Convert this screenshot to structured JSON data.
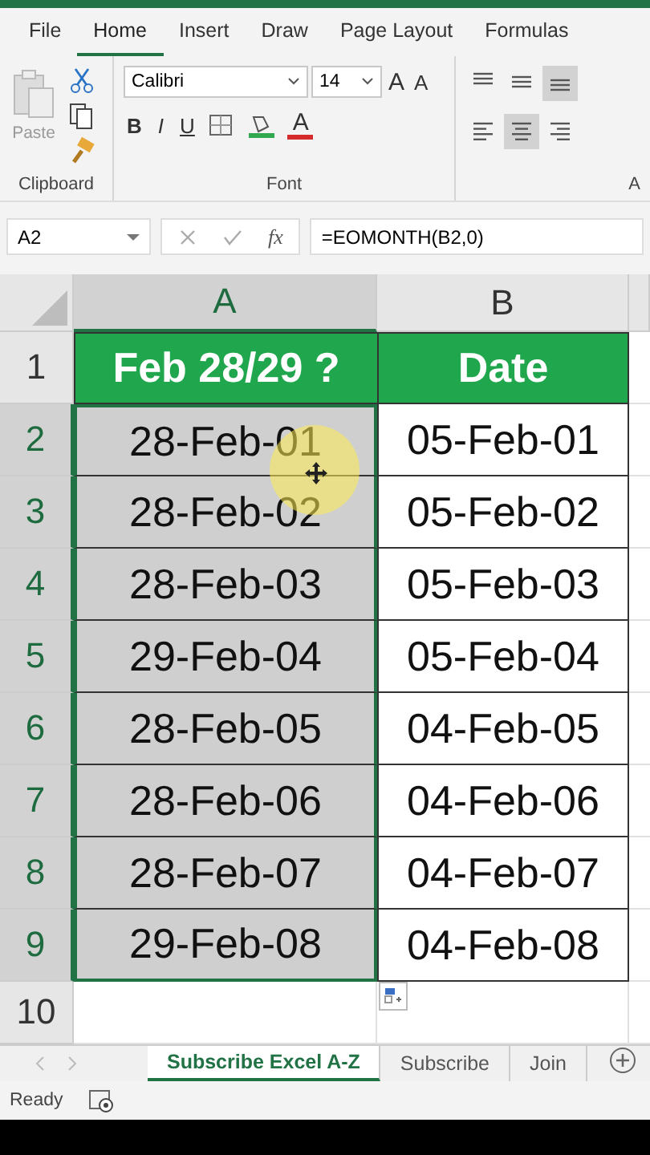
{
  "ribbon_tabs": [
    {
      "label": "File",
      "selected": false
    },
    {
      "label": "Home",
      "selected": true
    },
    {
      "label": "Insert",
      "selected": false
    },
    {
      "label": "Draw",
      "selected": false
    },
    {
      "label": "Page Layout",
      "selected": false
    },
    {
      "label": "Formulas",
      "selected": false
    }
  ],
  "clipboard": {
    "paste_label": "Paste",
    "group_label": "Clipboard"
  },
  "font": {
    "name": "Calibri",
    "size": "14",
    "grow": "A",
    "shrink": "A",
    "styles": [
      "B",
      "I",
      "U"
    ],
    "font_color": "A",
    "group_label": "Font"
  },
  "alignment": {
    "vertical": [
      {
        "selected": false
      },
      {
        "selected": false
      },
      {
        "selected": true
      }
    ],
    "horizontal": [
      {
        "selected": false
      },
      {
        "selected": true
      },
      {
        "selected": false
      }
    ],
    "group_label": "A"
  },
  "formula_bar": {
    "name_box": "A2",
    "fx": "fx",
    "formula": "=EOMONTH(B2,0)"
  },
  "columns": [
    {
      "label": "A",
      "selected": true
    },
    {
      "label": "B",
      "selected": false
    }
  ],
  "rows": [
    {
      "number": "1",
      "selected": false,
      "cells": [
        {
          "kind": "header",
          "text": "Feb 28/29 ?",
          "selected": false
        },
        {
          "kind": "header",
          "text": "Date",
          "selected": false
        }
      ]
    },
    {
      "number": "2",
      "selected": true,
      "cells": [
        {
          "kind": "data",
          "text": "28-Feb-01",
          "selected": true
        },
        {
          "kind": "data",
          "text": "05-Feb-01",
          "selected": false
        }
      ]
    },
    {
      "number": "3",
      "selected": true,
      "cells": [
        {
          "kind": "data",
          "text": "28-Feb-02",
          "selected": true
        },
        {
          "kind": "data",
          "text": "05-Feb-02",
          "selected": false
        }
      ]
    },
    {
      "number": "4",
      "selected": true,
      "cells": [
        {
          "kind": "data",
          "text": "28-Feb-03",
          "selected": true
        },
        {
          "kind": "data",
          "text": "05-Feb-03",
          "selected": false
        }
      ]
    },
    {
      "number": "5",
      "selected": true,
      "cells": [
        {
          "kind": "data",
          "text": "29-Feb-04",
          "selected": true
        },
        {
          "kind": "data",
          "text": "05-Feb-04",
          "selected": false
        }
      ]
    },
    {
      "number": "6",
      "selected": true,
      "cells": [
        {
          "kind": "data",
          "text": "28-Feb-05",
          "selected": true
        },
        {
          "kind": "data",
          "text": "04-Feb-05",
          "selected": false
        }
      ]
    },
    {
      "number": "7",
      "selected": true,
      "cells": [
        {
          "kind": "data",
          "text": "28-Feb-06",
          "selected": true
        },
        {
          "kind": "data",
          "text": "04-Feb-06",
          "selected": false
        }
      ]
    },
    {
      "number": "8",
      "selected": true,
      "cells": [
        {
          "kind": "data",
          "text": "28-Feb-07",
          "selected": true
        },
        {
          "kind": "data",
          "text": "04-Feb-07",
          "selected": false
        }
      ]
    },
    {
      "number": "9",
      "selected": true,
      "cells": [
        {
          "kind": "data",
          "text": "29-Feb-08",
          "selected": true
        },
        {
          "kind": "data",
          "text": "04-Feb-08",
          "selected": false
        }
      ]
    },
    {
      "number": "10",
      "selected": false
    }
  ],
  "sheet_tabs": [
    {
      "label": "Subscribe Excel A-Z",
      "selected": true
    },
    {
      "label": "Subscribe",
      "selected": false
    },
    {
      "label": "Join",
      "selected": false
    }
  ],
  "status": "Ready"
}
